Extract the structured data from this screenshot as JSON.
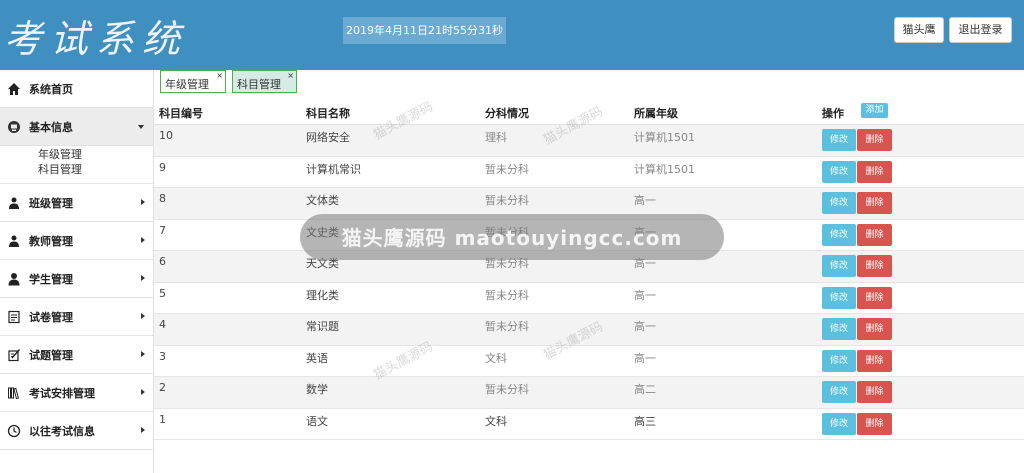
{
  "header": {
    "logo": "考试系统",
    "datetime": "2019年4月11日21时55分31秒",
    "user_label": "猫头鹰",
    "logout_label": "退出登录"
  },
  "sidebar": {
    "items": [
      {
        "label": "系统首页",
        "icon": "home-icon"
      },
      {
        "label": "基本信息",
        "icon": "info-icon"
      },
      {
        "label": "班级管理",
        "icon": "class-icon"
      },
      {
        "label": "教师管理",
        "icon": "teacher-icon"
      },
      {
        "label": "学生管理",
        "icon": "student-icon"
      },
      {
        "label": "试卷管理",
        "icon": "paper-icon"
      },
      {
        "label": "试题管理",
        "icon": "question-icon"
      },
      {
        "label": "考试安排管理",
        "icon": "books-icon"
      },
      {
        "label": "以往考试信息",
        "icon": "clock-icon"
      }
    ],
    "subitems": [
      "年级管理",
      "科目管理"
    ]
  },
  "tabs": [
    {
      "label": "年级管理",
      "close": "×"
    },
    {
      "label": "科目管理",
      "close": "×"
    }
  ],
  "table": {
    "headers": [
      "科目编号",
      "科目名称",
      "分科情况",
      "所属年级",
      "操作"
    ],
    "add_label": "添加",
    "edit_label": "修改",
    "delete_label": "删除",
    "rows": [
      [
        "10",
        "网络安全",
        "理科",
        "计算机1501"
      ],
      [
        "9",
        "计算机常识",
        "暂未分科",
        "计算机1501"
      ],
      [
        "8",
        "文体类",
        "暂未分科",
        "高一"
      ],
      [
        "7",
        "文史类",
        "暂未分科",
        "高一"
      ],
      [
        "6",
        "天文类",
        "暂未分科",
        "高一"
      ],
      [
        "5",
        "理化类",
        "暂未分科",
        "高一"
      ],
      [
        "4",
        "常识题",
        "暂未分科",
        "高一"
      ],
      [
        "3",
        "英语",
        "文科",
        "高一"
      ],
      [
        "2",
        "数学",
        "暂未分科",
        "高二"
      ],
      [
        "1",
        "语文",
        "文科",
        "高三"
      ]
    ]
  },
  "watermark": {
    "main": "猫头鹰源码 maotouyingcc.com",
    "small": "猫头鹰源码"
  },
  "colors": {
    "header_bg": "#3f8fc1",
    "edit": "#5bc0de",
    "delete": "#d9534f",
    "tab_border": "#4caf50"
  }
}
